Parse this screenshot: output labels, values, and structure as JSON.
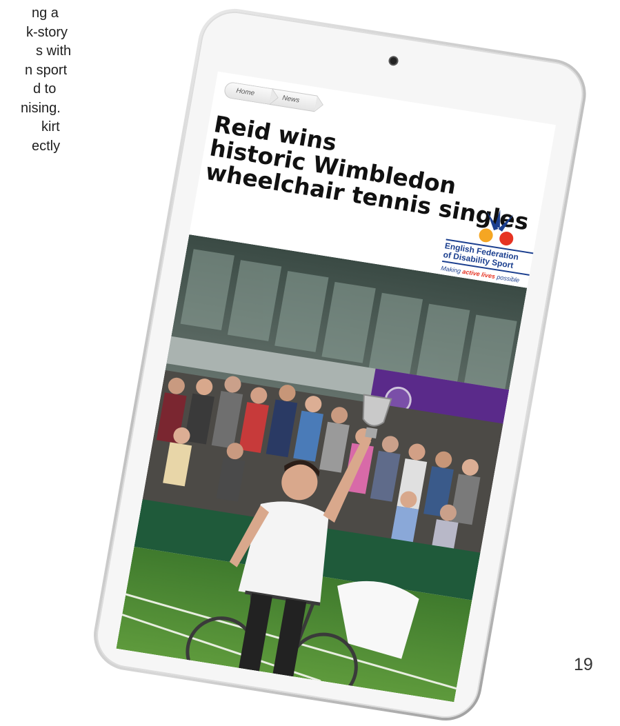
{
  "side_text": {
    "lines": [
      "ng a",
      "k-story",
      "s with",
      "n sport",
      "d to",
      "nising.",
      "kirt",
      "ectly"
    ]
  },
  "page_number": "19",
  "tablet": {
    "breadcrumb": [
      "Home",
      "News"
    ],
    "headline": [
      "Reid wins",
      "historic Wimbledon",
      "wheelchair tennis singles"
    ],
    "logo": {
      "name_line1": "English Federation",
      "name_line2": "of Disability Sport",
      "tagline_pre": "Making ",
      "tagline_highlight": "active lives",
      "tagline_post": " possible",
      "colors": [
        "#f5a623",
        "#e63322",
        "#1b3f8f"
      ]
    }
  }
}
